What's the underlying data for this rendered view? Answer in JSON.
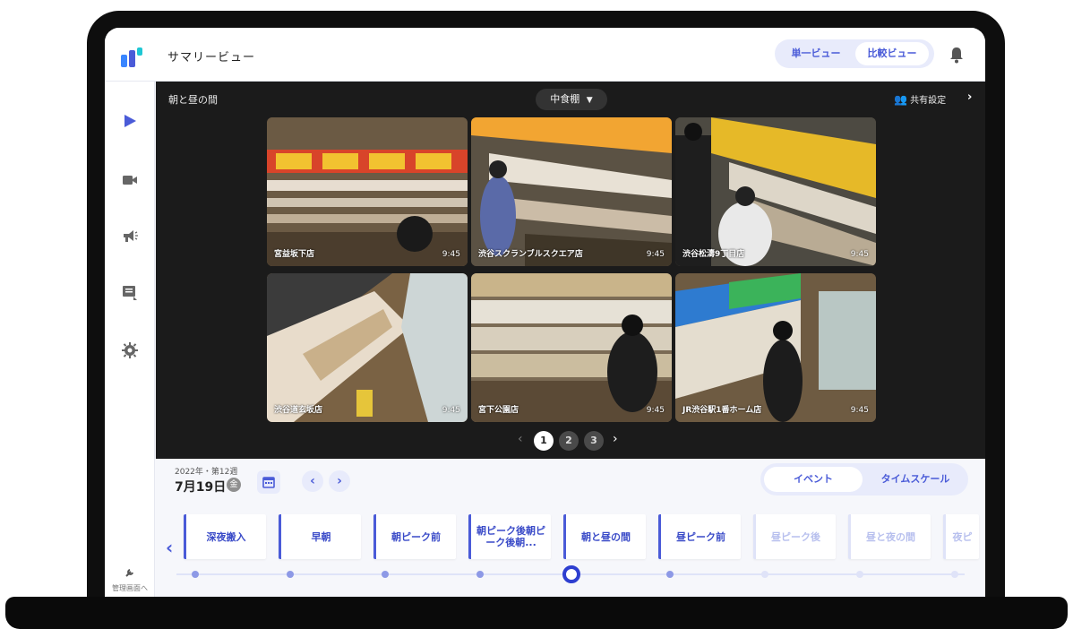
{
  "header": {
    "title": "サマリービュー",
    "view_single": "単一ビュー",
    "view_compare": "比較ビュー"
  },
  "sidebar": {
    "items": [
      {
        "icon": "play-icon"
      },
      {
        "icon": "video-camera-icon"
      },
      {
        "icon": "megaphone-icon"
      },
      {
        "icon": "report-icon"
      },
      {
        "icon": "gear-icon"
      }
    ],
    "admin_label": "管理画面へ"
  },
  "panel": {
    "zone": "朝と昼の間",
    "shelf": "中食棚",
    "share": "共有設定",
    "tiles": [
      {
        "store": "宮益坂下店",
        "time": "9:45"
      },
      {
        "store": "渋谷スクランブルスクエア店",
        "time": "9:45"
      },
      {
        "store": "渋谷松濤9丁目店",
        "time": "9:45"
      },
      {
        "store": "渋谷道玄坂店",
        "time": "9:45"
      },
      {
        "store": "宮下公園店",
        "time": "9:45"
      },
      {
        "store": "JR渋谷駅1番ホーム店",
        "time": "9:45"
      }
    ],
    "pages": [
      "1",
      "2",
      "3"
    ],
    "current_page": "1"
  },
  "timeline": {
    "date_sub": "2022年・第12週",
    "date_main": "7月19日",
    "weekday": "金",
    "mode_event": "イベント",
    "mode_scale": "タイムスケール",
    "events": [
      {
        "label": "深夜搬入",
        "state": "past"
      },
      {
        "label": "早朝",
        "state": "past"
      },
      {
        "label": "朝ピーク前",
        "state": "past"
      },
      {
        "label": "朝ピーク後朝ピーク後朝...",
        "state": "past"
      },
      {
        "label": "朝と昼の間",
        "state": "current"
      },
      {
        "label": "昼ピーク前",
        "state": "past"
      },
      {
        "label": "昼ピーク後",
        "state": "future"
      },
      {
        "label": "昼と夜の間",
        "state": "future"
      },
      {
        "label": "夜ピ",
        "state": "future"
      }
    ]
  },
  "colors": {
    "accent": "#4a5bd8",
    "panel_bg": "#1b1b1b",
    "toggle_bg": "#e8ebfb"
  }
}
